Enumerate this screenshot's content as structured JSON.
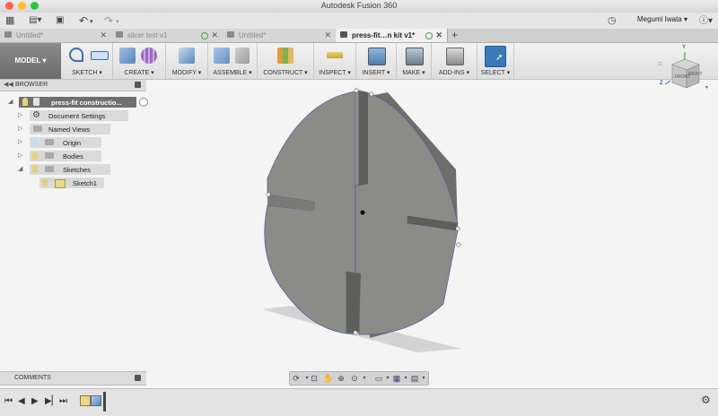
{
  "window": {
    "title": "Autodesk Fusion 360"
  },
  "appbar": {
    "user_name": "Megumi Iwata"
  },
  "tabs": [
    {
      "label": "Untitled*",
      "active": false
    },
    {
      "label": "slicer test v1",
      "active": false
    },
    {
      "label": "Untitled*",
      "active": false
    },
    {
      "label": "press-fit…n kit v1*",
      "active": true
    }
  ],
  "toolbar": {
    "workspace": "MODEL ▾",
    "groups": [
      "SKETCH ▾",
      "CREATE ▾",
      "MODIFY ▾",
      "ASSEMBLE ▾",
      "CONSTRUCT ▾",
      "INSPECT ▾",
      "INSERT ▾",
      "MAKE ▾",
      "ADD-INS ▾",
      "SELECT ▾"
    ]
  },
  "browser": {
    "header": "BROWSER",
    "root": "press-fit constructio...",
    "items": [
      "Document Settings",
      "Named Views",
      "Origin",
      "Bodies",
      "Sketches"
    ],
    "sketch_child": "Sketch1"
  },
  "viewcube": {
    "front": "FRONT",
    "right": "RIGHT",
    "axis_z": "Z",
    "axis_y": "Y"
  },
  "comments": {
    "label": "COMMENTS"
  },
  "colors": {
    "accent_select": "#3a7ab8",
    "model_button": "#7a7a7a",
    "body_face": "#8b8b87"
  }
}
